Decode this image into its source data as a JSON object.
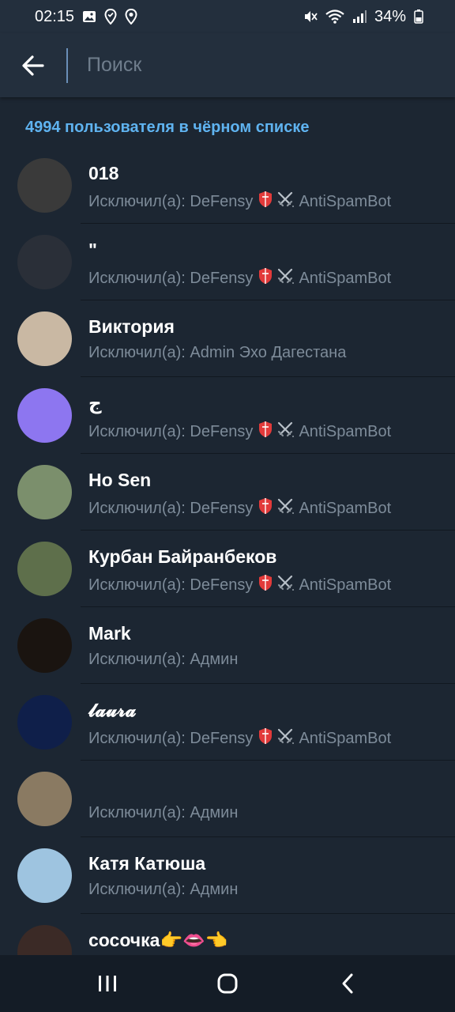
{
  "status_bar": {
    "time": "02:15",
    "battery": "34%"
  },
  "header": {
    "search_placeholder": "Поиск"
  },
  "section": {
    "title": "4994 пользователя в чёрном списке"
  },
  "rows": [
    {
      "name": "018",
      "prefix": "Исключил(а): DeFensy",
      "bot": "AntiSpamBot",
      "has_bot": true,
      "avatar_color": "#3a3a3a"
    },
    {
      "name": "\"",
      "prefix": "Исключил(а): DeFensy",
      "bot": "AntiSpamBot",
      "has_bot": true,
      "avatar_color": "#2a2f38"
    },
    {
      "name": "Виктория",
      "prefix": "Исключил(а): Admin Эхо Дагестана",
      "bot": "",
      "has_bot": false,
      "avatar_color": "#c9b8a3"
    },
    {
      "name": "ج",
      "prefix": "Исключил(а): DeFensy",
      "bot": "AntiSpamBot",
      "has_bot": true,
      "avatar_color": "#8d76f0"
    },
    {
      "name": "Ho Sen",
      "prefix": "Исключил(а): DeFensy",
      "bot": "AntiSpamBot",
      "has_bot": true,
      "avatar_color": "#7b8f6c"
    },
    {
      "name": "Курбан Байранбеков",
      "prefix": "Исключил(а): DeFensy",
      "bot": "AntiSpamBot",
      "has_bot": true,
      "avatar_color": "#5e6f4b"
    },
    {
      "name": "Mark",
      "prefix": "Исключил(а): Админ",
      "bot": "",
      "has_bot": false,
      "avatar_color": "#1a1410"
    },
    {
      "name": "𝓵𝓪𝓾𝓻𝓪",
      "prefix": "Исключил(а): DeFensy",
      "bot": "AntiSpamBot",
      "has_bot": true,
      "avatar_color": "#0f1f4a"
    },
    {
      "name": "",
      "prefix": "Исключил(а): Админ",
      "bot": "",
      "has_bot": false,
      "avatar_color": "#8a7a62"
    },
    {
      "name": "Катя Катюша",
      "prefix": "Исключил(а): Админ",
      "bot": "",
      "has_bot": false,
      "avatar_color": "#9ec4e0"
    },
    {
      "name": "сосочка👉👄👈",
      "prefix": "",
      "bot": "",
      "has_bot": false,
      "avatar_color": "#3b2a26"
    }
  ],
  "icons": {
    "back": "arrow-left-icon",
    "nav_recent": "recent-apps-icon",
    "nav_home": "home-icon",
    "nav_back": "chevron-left-icon"
  },
  "colors": {
    "accent": "#5fb3f0",
    "background": "#1c2632",
    "header": "#232f3d"
  }
}
